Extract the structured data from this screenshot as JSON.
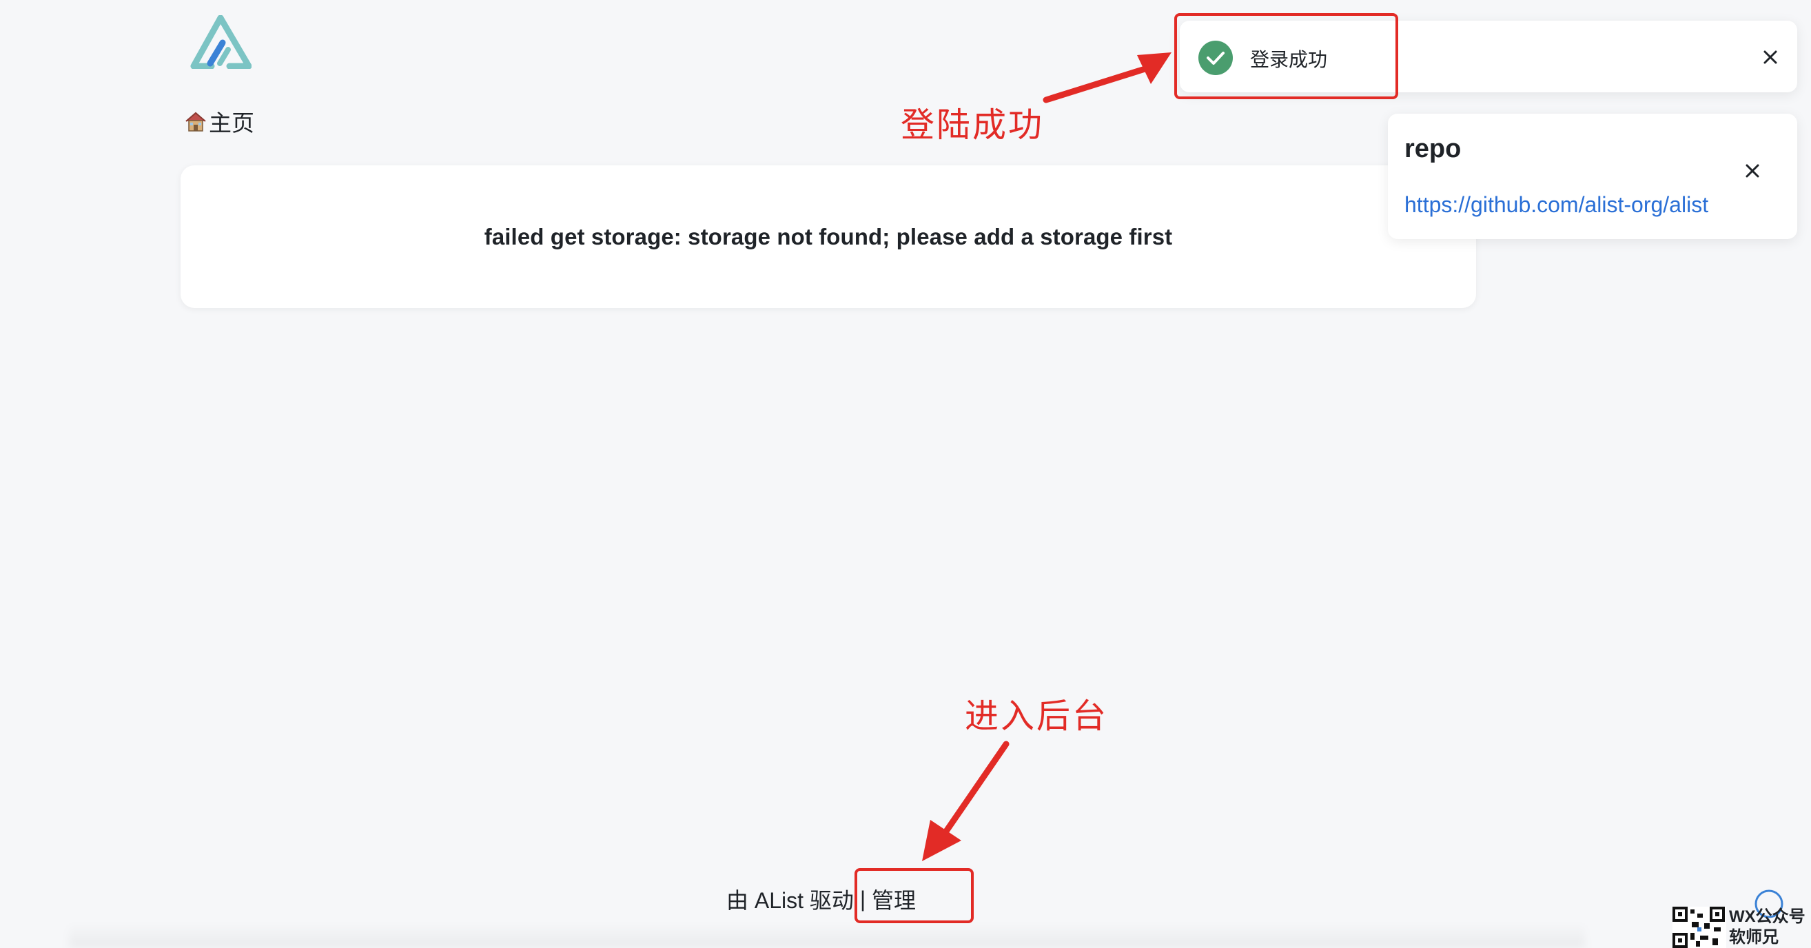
{
  "header": {
    "logo_icon": "alist-logo-icon",
    "breadcrumb_icon": "house-icon",
    "breadcrumb_label": "主页"
  },
  "main": {
    "error_message": "failed get storage: storage not found; please add a storage first"
  },
  "toasts": {
    "success": {
      "icon": "check-circle-icon",
      "message": "登录成功",
      "close_icon": "close-icon"
    },
    "repo": {
      "title": "repo",
      "link": "https://github.com/alist-org/alist",
      "close_icon": "close-icon"
    }
  },
  "annotations": {
    "login_success": "登陆成功",
    "enter_admin": "进入后台",
    "color": "#e22b26"
  },
  "footer": {
    "powered_by": "由 AList 驱动",
    "separator": " | ",
    "manage": "管理"
  },
  "watermark": {
    "line1": "WX公众号",
    "line2": "软师兄"
  },
  "colors": {
    "background": "#f6f7f9",
    "accent_success": "#4a9d6e",
    "link": "#2a6fd6",
    "logo_teal": "#7cc4c4",
    "logo_blue": "#3b82d6"
  }
}
